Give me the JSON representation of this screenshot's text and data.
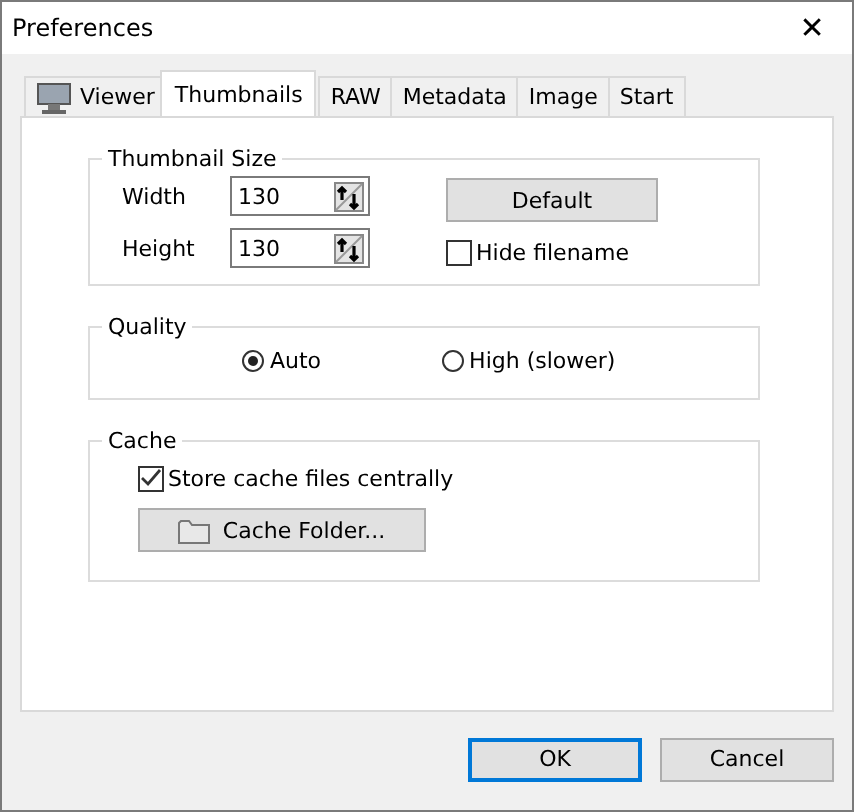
{
  "window": {
    "title": "Preferences",
    "close": "✕"
  },
  "tabs": [
    {
      "label": "Viewer",
      "kind": "with-icon",
      "selected": false
    },
    {
      "label": "Thumbnails",
      "kind": "plain",
      "selected": true
    },
    {
      "label": "RAW",
      "kind": "plain",
      "selected": false
    },
    {
      "label": "Metadata",
      "kind": "plain",
      "selected": false
    },
    {
      "label": "Image",
      "kind": "plain",
      "selected": false
    },
    {
      "label": "Start",
      "kind": "plain",
      "selected": false
    }
  ],
  "thumbnail_size": {
    "title": "Thumbnail Size",
    "fields": [
      {
        "label": "Width",
        "value": "130"
      },
      {
        "label": "Height",
        "value": "130"
      }
    ],
    "default_button": "Default",
    "hide_filename": {
      "label": "Hide filename",
      "checked": false
    }
  },
  "quality": {
    "title": "Quality",
    "options": [
      {
        "label": "Auto",
        "selected": true
      },
      {
        "label": "High (slower)",
        "selected": false
      }
    ]
  },
  "cache": {
    "title": "Cache",
    "store_centrally": {
      "label": "Store cache files centrally",
      "checked": true
    },
    "folder_button": "Cache Folder..."
  },
  "buttons": [
    {
      "label": "OK",
      "kind": "default"
    },
    {
      "label": "Cancel",
      "kind": "normal"
    }
  ]
}
